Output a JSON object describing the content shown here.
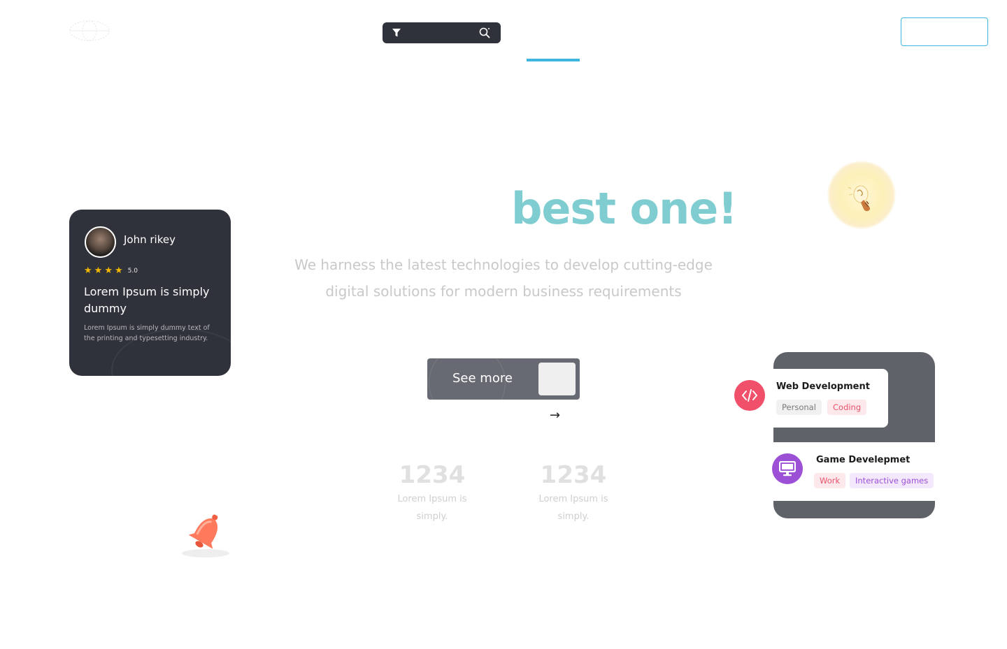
{
  "header": {
    "logo": "logo-icon",
    "search": {
      "filter_icon": "filter-icon",
      "search_icon": "search-icon"
    },
    "nav_active_color": "#3fb6de",
    "cta_border_color": "#3fb6de"
  },
  "hero": {
    "title": "best one!",
    "subtitle_line1": "We harness the latest technologies to develop cutting-edge",
    "subtitle_line2": "digital solutions for modern business requirements",
    "title_color": "#7fcdd0"
  },
  "review": {
    "name": "John rikey",
    "rating": "5.0",
    "stars": 5,
    "title": "Lorem Ipsum is simply dummy",
    "text": "Lorem Ipsum is simply dummy text of the printing and typesetting industry."
  },
  "cta": {
    "label": "See more",
    "arrow": "→"
  },
  "stats": [
    {
      "number": "1234",
      "line1": "Lorem Ipsum is",
      "line2": "simply."
    },
    {
      "number": "1234",
      "line1": "Lorem Ipsum is",
      "line2": "simply."
    }
  ],
  "services": {
    "web": {
      "title": "Web Development",
      "tags": [
        "Personal",
        "Coding"
      ],
      "icon": "code-icon"
    },
    "game": {
      "title": "Game Develepmet",
      "tags": [
        "Work",
        "Interactive games"
      ],
      "icon": "monitor-icon"
    }
  },
  "decorations": {
    "bulb": "lightbulb-icon",
    "bell": "bell-icon"
  }
}
